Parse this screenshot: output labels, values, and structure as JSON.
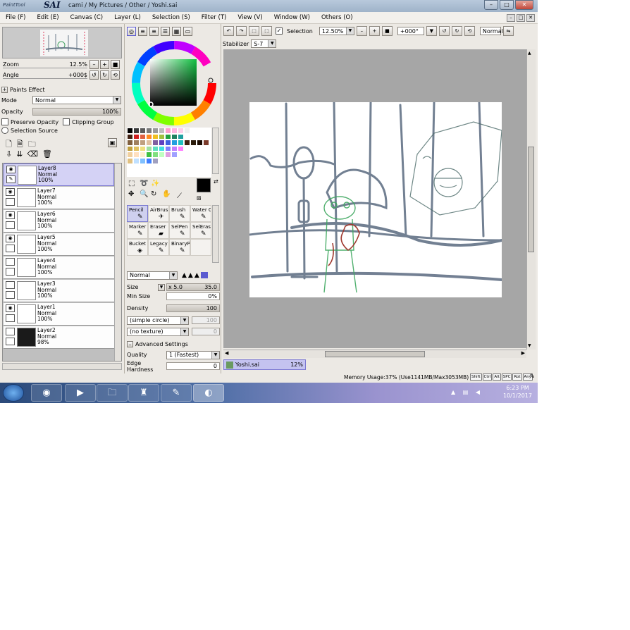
{
  "app": {
    "title": "cami / My Pictures / Other / Yoshi.sai",
    "logo_text": "PaintTool SAI"
  },
  "window_buttons": {
    "minimize": "–",
    "maximize": "□",
    "close": "✕"
  },
  "menu": [
    "File (F)",
    "Edit (E)",
    "Canvas (C)",
    "Layer (L)",
    "Selection (S)",
    "Filter (T)",
    "View (V)",
    "Window (W)",
    "Others (O)"
  ],
  "navigator": {
    "zoom_label": "Zoom",
    "zoom_value": "12.5%",
    "angle_label": "Angle",
    "angle_value": "+000$"
  },
  "paint_effect": {
    "header": "Paints Effect",
    "mode_label": "Mode",
    "mode_value": "Normal",
    "opacity_label": "Opacity",
    "opacity_value": "100%",
    "preserve_opacity": "Preserve Opacity",
    "clipping_group": "Clipping Group",
    "selection_source": "Selection Source"
  },
  "layers": [
    {
      "name": "Layer8",
      "mode": "Normal",
      "opacity": "100%",
      "visible": true,
      "selected": true
    },
    {
      "name": "Layer7",
      "mode": "Normal",
      "opacity": "100%",
      "visible": true,
      "selected": false
    },
    {
      "name": "Layer6",
      "mode": "Normal",
      "opacity": "100%",
      "visible": true,
      "selected": false
    },
    {
      "name": "Layer5",
      "mode": "Normal",
      "opacity": "100%",
      "visible": true,
      "selected": false
    },
    {
      "name": "Layer4",
      "mode": "Normal",
      "opacity": "100%",
      "visible": false,
      "selected": false
    },
    {
      "name": "Layer3",
      "mode": "Normal",
      "opacity": "100%",
      "visible": false,
      "selected": false
    },
    {
      "name": "Layer1",
      "mode": "Normal",
      "opacity": "100%",
      "visible": true,
      "selected": false
    },
    {
      "name": "Layer2",
      "mode": "Normal",
      "opacity": "98%",
      "visible": false,
      "selected": false
    }
  ],
  "palette_colors": [
    "#000000",
    "#3a3a3a",
    "#5a5a5a",
    "#7a7a7a",
    "#9a9a9a",
    "#bdbdbd",
    "#ff9fd0",
    "#ffb6e0",
    "#ffd0ea",
    "#f0f0f0",
    "#ffffff",
    "#ffffff",
    "#ffffff",
    "#402010",
    "#d02020",
    "#e06040",
    "#ff8a20",
    "#f0c020",
    "#a0c040",
    "#20a040",
    "#208060",
    "#20a0a0",
    "#ffffff",
    "#ffffff",
    "#ffffff",
    "#ffffff",
    "#806040",
    "#a08060",
    "#c0a080",
    "#e0c0a0",
    "#8060a0",
    "#6040c0",
    "#4060e0",
    "#20a0e0",
    "#20c0c0",
    "#402010",
    "#2a1a0a",
    "#1a0a00",
    "#7a3a2a",
    "#c0a040",
    "#e0c060",
    "#f0e080",
    "#a0e0a0",
    "#60e0c0",
    "#40e0e0",
    "#8080ff",
    "#c080ff",
    "#ff80ff",
    "#ffffff",
    "#ffffff",
    "#ffffff",
    "#ffffff",
    "#f0d0a0",
    "#ffe0c0",
    "#fff0d0",
    "#40c040",
    "#80e080",
    "#c0ffc0",
    "#e0a0e0",
    "#a0a0ff",
    "#ffffff",
    "#ffffff",
    "#ffffff",
    "#ffffff",
    "#ffffff",
    "#e0c080",
    "#c0e0ff",
    "#80c0ff",
    "#4080ff",
    "#a0a0c0",
    "#ffffff",
    "#ffffff",
    "#ffffff",
    "#ffffff",
    "#ffffff",
    "#ffffff",
    "#ffffff",
    "#ffffff"
  ],
  "tools": [
    {
      "name": "Pencil",
      "icon": "✎",
      "selected": true
    },
    {
      "name": "AirBrush",
      "icon": "✈",
      "selected": false
    },
    {
      "name": "Brush",
      "icon": "✎",
      "selected": false
    },
    {
      "name": "Water Color",
      "icon": "✎",
      "selected": false
    },
    {
      "name": "Marker",
      "icon": "✎",
      "selected": false
    },
    {
      "name": "Eraser",
      "icon": "▰",
      "selected": false
    },
    {
      "name": "SelPen",
      "icon": "✎",
      "selected": false
    },
    {
      "name": "SelEras",
      "icon": "✎",
      "selected": false
    },
    {
      "name": "Bucket",
      "icon": "◈",
      "selected": false
    },
    {
      "name": "Legacy Pen",
      "icon": "✎",
      "selected": false
    },
    {
      "name": "BinaryPe",
      "icon": "✎",
      "selected": false
    },
    {
      "name": "",
      "icon": "",
      "selected": false
    }
  ],
  "brush": {
    "blend_mode": "Normal",
    "size_label": "Size",
    "size_mult": "x 5.0",
    "size_value": "35.0",
    "min_size_label": "Min Size",
    "min_size_value": "0%",
    "density_label": "Density",
    "density_value": "100",
    "shape": "(simple circle)",
    "shape_value": "100",
    "texture": "(no texture)",
    "texture_value": "0",
    "advanced": "Advanced Settings",
    "quality_label": "Quality",
    "quality_value": "1 (Fastest)",
    "edge_label": "Edge Hardness",
    "edge_value": "0"
  },
  "canvas_toolbar": {
    "selection_label": "Selection",
    "zoom": "12.50%",
    "angle": "+000°",
    "mode": "Normal",
    "stabilizer_label": "Stabilizer",
    "stabilizer_value": "S-7"
  },
  "document_tab": {
    "name": "Yoshi.sai",
    "zoom": "12%"
  },
  "status": {
    "memory": "Memory Usage:37% (Use1141MB/Max3053MB)",
    "keys": [
      "Shift",
      "Ctrl",
      "Alt",
      "SPC",
      "Rot",
      "Any"
    ]
  },
  "taskbar": {
    "time": "6:23 PM",
    "date": "10/1/2017"
  },
  "colors": {
    "selected_layer": "#d4d2f5",
    "primary_color": "#000000",
    "canvas_bg": "#a6a6a6"
  }
}
